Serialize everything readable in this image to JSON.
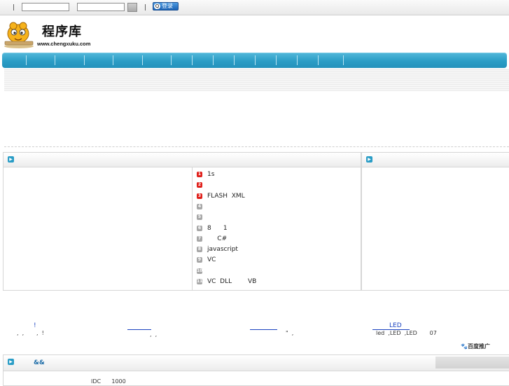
{
  "topbar": {
    "separator": "|",
    "username_value": "",
    "password_value": "",
    "qq_login_label": "登录",
    "qq_glyph": "Q"
  },
  "logo": {
    "name": "程序库",
    "url_text": "www.chengxuku.com"
  },
  "left_panel": {
    "title": ""
  },
  "right_panel": {
    "title": ""
  },
  "ranking": [
    {
      "num": "1",
      "text": "1s",
      "hot": true
    },
    {
      "num": "2",
      "text": "",
      "hot": true
    },
    {
      "num": "3",
      "text": "FLASH  XML",
      "hot": true
    },
    {
      "num": "4",
      "text": "",
      "hot": false
    },
    {
      "num": "5",
      "text": "",
      "hot": false
    },
    {
      "num": "6",
      "text": "8      1",
      "hot": false
    },
    {
      "num": "7",
      "text": "     C#",
      "hot": false
    },
    {
      "num": "8",
      "text": "javascript",
      "hot": false
    },
    {
      "num": "9",
      "text": "VC",
      "hot": false
    },
    {
      "num": "10",
      "text": "",
      "hot": false
    },
    {
      "num": "11",
      "text": "VC  DLL        VB",
      "hot": false
    }
  ],
  "ads": {
    "ad1_title": "!",
    "ad1_desc": ",  ,       ,  !",
    "ad2_desc": ",  ,",
    "ad3_desc": "\"  ,",
    "ad4_title": "LED",
    "ad4_desc": "led  ,LED  ,LED       07",
    "baidu_label": "百度推广",
    "baidu_glyph": "🐾"
  },
  "bottom_panel": {
    "title": "&&",
    "snippet": "IDC      1000"
  },
  "colors": {
    "nav_blue": "#2a9dc6",
    "rank_hot": "#e0201b",
    "rank_cold": "#a7a7a7",
    "link_blue": "#1a43c0"
  }
}
